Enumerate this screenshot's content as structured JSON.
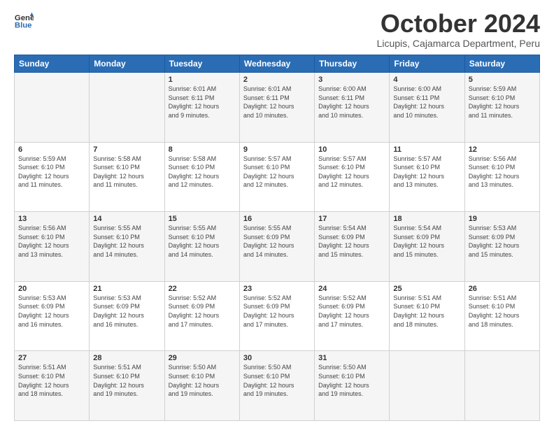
{
  "logo": {
    "line1": "General",
    "line2": "Blue"
  },
  "title": "October 2024",
  "location": "Licupis, Cajamarca Department, Peru",
  "days_of_week": [
    "Sunday",
    "Monday",
    "Tuesday",
    "Wednesday",
    "Thursday",
    "Friday",
    "Saturday"
  ],
  "weeks": [
    [
      {
        "day": "",
        "info": ""
      },
      {
        "day": "",
        "info": ""
      },
      {
        "day": "1",
        "info": "Sunrise: 6:01 AM\nSunset: 6:11 PM\nDaylight: 12 hours\nand 9 minutes."
      },
      {
        "day": "2",
        "info": "Sunrise: 6:01 AM\nSunset: 6:11 PM\nDaylight: 12 hours\nand 10 minutes."
      },
      {
        "day": "3",
        "info": "Sunrise: 6:00 AM\nSunset: 6:11 PM\nDaylight: 12 hours\nand 10 minutes."
      },
      {
        "day": "4",
        "info": "Sunrise: 6:00 AM\nSunset: 6:11 PM\nDaylight: 12 hours\nand 10 minutes."
      },
      {
        "day": "5",
        "info": "Sunrise: 5:59 AM\nSunset: 6:10 PM\nDaylight: 12 hours\nand 11 minutes."
      }
    ],
    [
      {
        "day": "6",
        "info": "Sunrise: 5:59 AM\nSunset: 6:10 PM\nDaylight: 12 hours\nand 11 minutes."
      },
      {
        "day": "7",
        "info": "Sunrise: 5:58 AM\nSunset: 6:10 PM\nDaylight: 12 hours\nand 11 minutes."
      },
      {
        "day": "8",
        "info": "Sunrise: 5:58 AM\nSunset: 6:10 PM\nDaylight: 12 hours\nand 12 minutes."
      },
      {
        "day": "9",
        "info": "Sunrise: 5:57 AM\nSunset: 6:10 PM\nDaylight: 12 hours\nand 12 minutes."
      },
      {
        "day": "10",
        "info": "Sunrise: 5:57 AM\nSunset: 6:10 PM\nDaylight: 12 hours\nand 12 minutes."
      },
      {
        "day": "11",
        "info": "Sunrise: 5:57 AM\nSunset: 6:10 PM\nDaylight: 12 hours\nand 13 minutes."
      },
      {
        "day": "12",
        "info": "Sunrise: 5:56 AM\nSunset: 6:10 PM\nDaylight: 12 hours\nand 13 minutes."
      }
    ],
    [
      {
        "day": "13",
        "info": "Sunrise: 5:56 AM\nSunset: 6:10 PM\nDaylight: 12 hours\nand 13 minutes."
      },
      {
        "day": "14",
        "info": "Sunrise: 5:55 AM\nSunset: 6:10 PM\nDaylight: 12 hours\nand 14 minutes."
      },
      {
        "day": "15",
        "info": "Sunrise: 5:55 AM\nSunset: 6:10 PM\nDaylight: 12 hours\nand 14 minutes."
      },
      {
        "day": "16",
        "info": "Sunrise: 5:55 AM\nSunset: 6:09 PM\nDaylight: 12 hours\nand 14 minutes."
      },
      {
        "day": "17",
        "info": "Sunrise: 5:54 AM\nSunset: 6:09 PM\nDaylight: 12 hours\nand 15 minutes."
      },
      {
        "day": "18",
        "info": "Sunrise: 5:54 AM\nSunset: 6:09 PM\nDaylight: 12 hours\nand 15 minutes."
      },
      {
        "day": "19",
        "info": "Sunrise: 5:53 AM\nSunset: 6:09 PM\nDaylight: 12 hours\nand 15 minutes."
      }
    ],
    [
      {
        "day": "20",
        "info": "Sunrise: 5:53 AM\nSunset: 6:09 PM\nDaylight: 12 hours\nand 16 minutes."
      },
      {
        "day": "21",
        "info": "Sunrise: 5:53 AM\nSunset: 6:09 PM\nDaylight: 12 hours\nand 16 minutes."
      },
      {
        "day": "22",
        "info": "Sunrise: 5:52 AM\nSunset: 6:09 PM\nDaylight: 12 hours\nand 17 minutes."
      },
      {
        "day": "23",
        "info": "Sunrise: 5:52 AM\nSunset: 6:09 PM\nDaylight: 12 hours\nand 17 minutes."
      },
      {
        "day": "24",
        "info": "Sunrise: 5:52 AM\nSunset: 6:09 PM\nDaylight: 12 hours\nand 17 minutes."
      },
      {
        "day": "25",
        "info": "Sunrise: 5:51 AM\nSunset: 6:10 PM\nDaylight: 12 hours\nand 18 minutes."
      },
      {
        "day": "26",
        "info": "Sunrise: 5:51 AM\nSunset: 6:10 PM\nDaylight: 12 hours\nand 18 minutes."
      }
    ],
    [
      {
        "day": "27",
        "info": "Sunrise: 5:51 AM\nSunset: 6:10 PM\nDaylight: 12 hours\nand 18 minutes."
      },
      {
        "day": "28",
        "info": "Sunrise: 5:51 AM\nSunset: 6:10 PM\nDaylight: 12 hours\nand 19 minutes."
      },
      {
        "day": "29",
        "info": "Sunrise: 5:50 AM\nSunset: 6:10 PM\nDaylight: 12 hours\nand 19 minutes."
      },
      {
        "day": "30",
        "info": "Sunrise: 5:50 AM\nSunset: 6:10 PM\nDaylight: 12 hours\nand 19 minutes."
      },
      {
        "day": "31",
        "info": "Sunrise: 5:50 AM\nSunset: 6:10 PM\nDaylight: 12 hours\nand 19 minutes."
      },
      {
        "day": "",
        "info": ""
      },
      {
        "day": "",
        "info": ""
      }
    ]
  ]
}
